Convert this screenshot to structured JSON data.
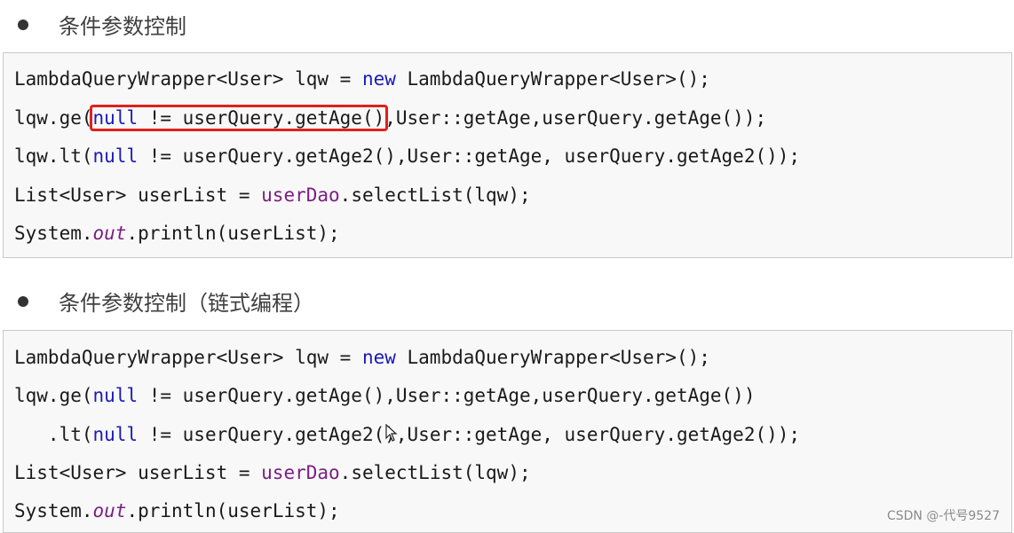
{
  "section1": {
    "heading": "条件参数控制",
    "lines": [
      [
        "LambdaQueryWrapper<User> lqw = ",
        "new",
        " LambdaQueryWrapper<User>();"
      ],
      [
        "lqw.ge(",
        "null",
        " != userQuery.getAge()",
        ",User::getAge,userQuery.getAge());"
      ],
      [
        "lqw.lt(",
        "null",
        " != userQuery.getAge2(),User::getAge, userQuery.getAge2());"
      ],
      [
        "List<User> userList = ",
        "userDao",
        ".selectList(lqw);"
      ],
      [
        "System.",
        "out",
        ".println(userList);"
      ]
    ]
  },
  "section2": {
    "heading": "条件参数控制（链式编程）",
    "lines": [
      [
        "LambdaQueryWrapper<User> lqw = ",
        "new",
        " LambdaQueryWrapper<User>();"
      ],
      [
        "lqw.ge(",
        "null",
        " != userQuery.getAge(),User::getAge,userQuery.getAge())"
      ],
      [
        "   .lt(",
        "null",
        " != userQuery.getAge2(),User::getAge, userQuery.getAge2());"
      ],
      [
        "List<User> userList = ",
        "userDao",
        ".selectList(lqw);"
      ],
      [
        "System.",
        "out",
        ".println(userList);"
      ]
    ]
  },
  "watermark": "CSDN @-代号9527",
  "colors": {
    "keyword": "#1a1ab8",
    "field": "#7a1f82",
    "highlight_border": "#e0201c",
    "code_background": "#f8f8f8"
  },
  "icons": [
    "bullet-icon",
    "mouse-cursor-icon"
  ]
}
